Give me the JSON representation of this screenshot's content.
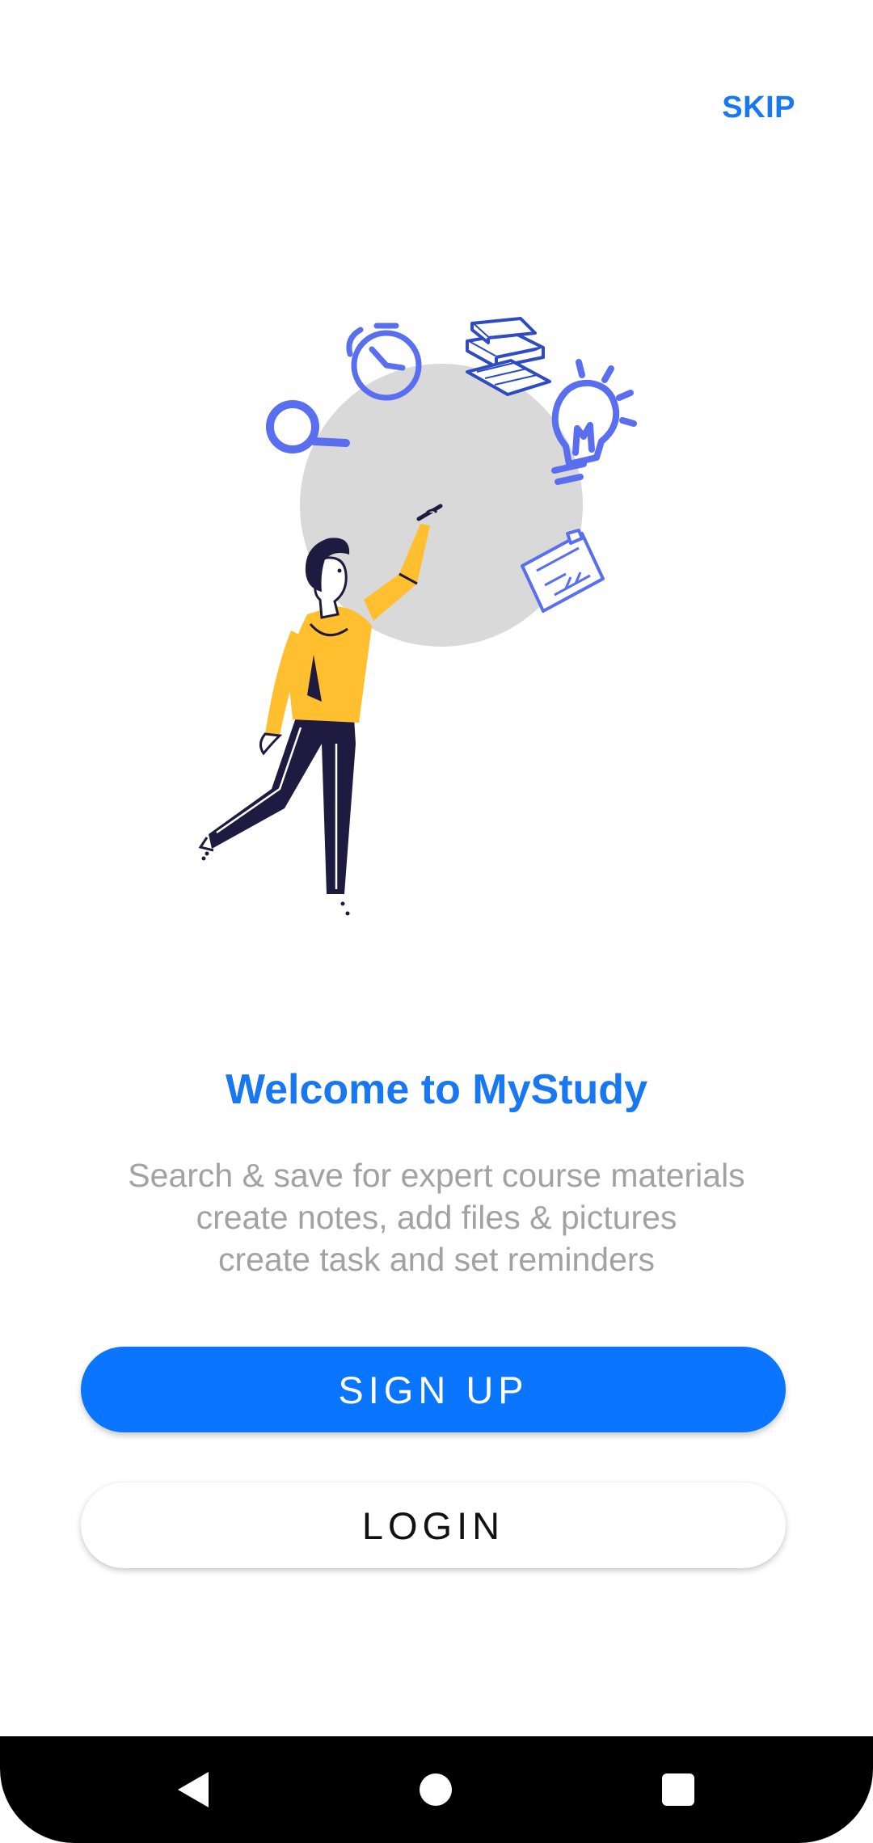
{
  "onboarding": {
    "skip_label": "SKIP",
    "title": "Welcome to MyStudy",
    "subtitle_lines": [
      "Search & save for expert course materials",
      "create notes, add files & pictures",
      "create task and set reminders"
    ],
    "signup_label": "SIGN UP",
    "login_label": "LOGIN"
  },
  "illustration": {
    "icons": [
      "magnifier-icon",
      "stopwatch-icon",
      "books-icon",
      "lightbulb-icon",
      "checklist-icon"
    ]
  },
  "navbar": {
    "buttons": [
      "back-icon",
      "home-icon",
      "recents-icon"
    ]
  },
  "colors": {
    "accent": "#1877f2",
    "button_primary": "#0a75ff",
    "subtitle": "#a2a2a2",
    "icon_blue": "#5a6ff0",
    "hoodie": "#ffbf2f",
    "pants": "#1f1a3f",
    "circle": "#d9d9d9"
  }
}
